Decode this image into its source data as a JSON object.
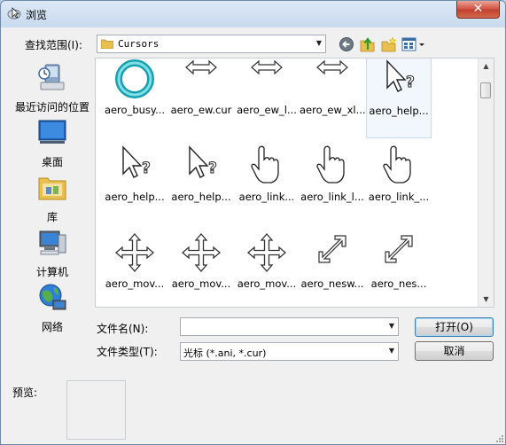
{
  "window": {
    "title": "浏览",
    "close_glyph": "✕"
  },
  "toolbar": {
    "look_in_label": "查找范围(I):",
    "look_in_value": "Cursors",
    "back_icon": "back-arrow-icon",
    "up_icon": "up-folder-icon",
    "new_folder_icon": "new-folder-icon",
    "views_icon": "views-menu-icon"
  },
  "places": [
    {
      "label": "最近访问的位置",
      "icon": "recent-places-icon"
    },
    {
      "label": "桌面",
      "icon": "desktop-icon"
    },
    {
      "label": "库",
      "icon": "libraries-icon"
    },
    {
      "label": "计算机",
      "icon": "computer-icon"
    },
    {
      "label": "网络",
      "icon": "network-icon"
    }
  ],
  "files": [
    {
      "name": "aero_busy...",
      "icon": "busy-ring"
    },
    {
      "name": "aero_ew.cur",
      "icon": "ew-arrow"
    },
    {
      "name": "aero_ew_l...",
      "icon": "ew-arrow"
    },
    {
      "name": "aero_ew_xl...",
      "icon": "ew-arrow"
    },
    {
      "name": "aero_help...",
      "icon": "help-select",
      "selected": true
    },
    {
      "name": "aero_help...",
      "icon": "help-select"
    },
    {
      "name": "aero_help...",
      "icon": "help-select"
    },
    {
      "name": "aero_link...",
      "icon": "hand"
    },
    {
      "name": "aero_link_l...",
      "icon": "hand"
    },
    {
      "name": "aero_link_...",
      "icon": "hand"
    },
    {
      "name": "aero_mov...",
      "icon": "move"
    },
    {
      "name": "aero_mov...",
      "icon": "move"
    },
    {
      "name": "aero_mov...",
      "icon": "move"
    },
    {
      "name": "aero_nesw...",
      "icon": "nesw-arrow"
    },
    {
      "name": "aero_nes...",
      "icon": "nesw-arrow"
    }
  ],
  "filename": {
    "label": "文件名(N):",
    "value": ""
  },
  "filetype": {
    "label": "文件类型(T):",
    "value": "光标 (*.ani, *.cur)"
  },
  "buttons": {
    "open": "打开(O)",
    "cancel": "取消"
  },
  "preview": {
    "label": "预览:"
  }
}
